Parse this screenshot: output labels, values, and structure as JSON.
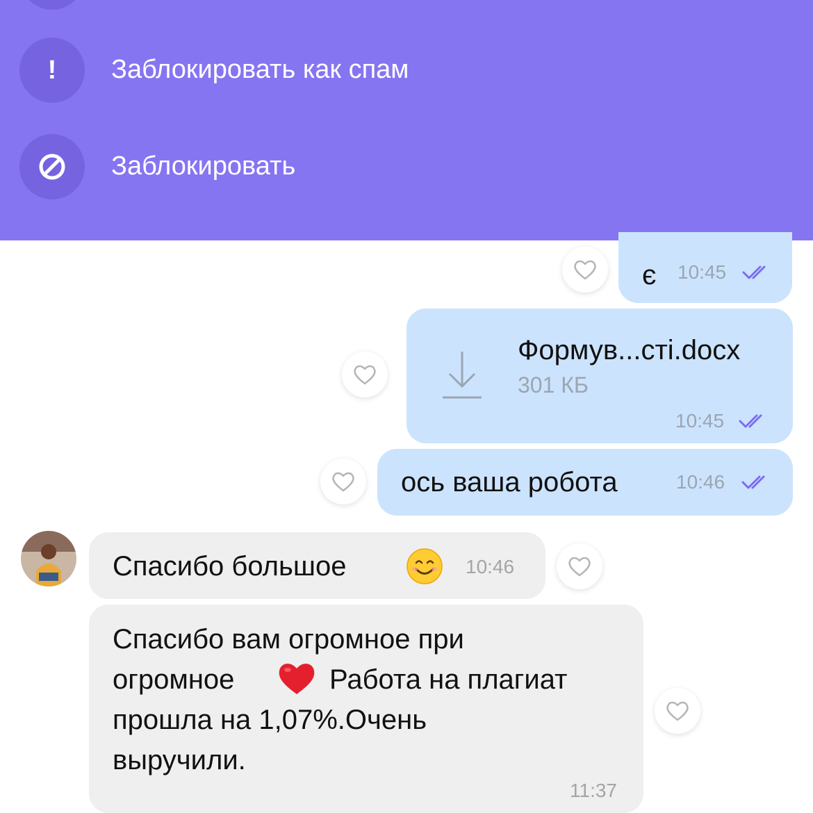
{
  "menu": {
    "items": [
      {
        "label": "Заблокировать как спам",
        "icon": "exclamation-icon",
        "glyph": "!"
      },
      {
        "label": "Заблокировать",
        "icon": "block-icon"
      }
    ]
  },
  "chat": {
    "messages": [
      {
        "direction": "out",
        "text": "є",
        "time": "10:45",
        "status": "read"
      },
      {
        "direction": "out",
        "type": "file",
        "file_name": "Формув...сті.docx",
        "file_size": "301 КБ",
        "time": "10:45",
        "status": "read"
      },
      {
        "direction": "out",
        "text": "ось ваша робота",
        "time": "10:46",
        "status": "read"
      },
      {
        "direction": "in",
        "text": "Спасибо большое",
        "emoji": "smiling-face",
        "time": "10:46"
      },
      {
        "direction": "in",
        "lines": [
          "Спасибо вам огромное при",
          "огромное",
          "Работа на плагиат",
          "прошла на 1,07%.Очень",
          "выручили."
        ],
        "emoji": "red-heart",
        "time": "11:37"
      }
    ]
  },
  "colors": {
    "panel": "#8575f1",
    "icon_circle": "#7663df",
    "outgoing": "#cce3fd",
    "incoming": "#efefef",
    "read_ticks": "#7b6cf0"
  }
}
